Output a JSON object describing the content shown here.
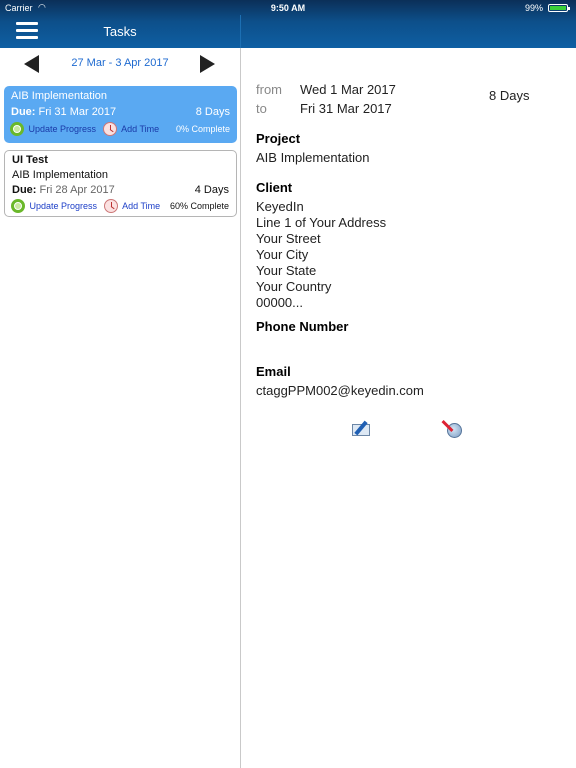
{
  "status_bar": {
    "carrier": "Carrier",
    "time": "9:50 AM",
    "battery": "99%"
  },
  "header": {
    "title": "Tasks"
  },
  "week_nav": {
    "label": "27 Mar - 3 Apr 2017"
  },
  "tasks": [
    {
      "title": "AIB Implementation",
      "due_label": "Due:",
      "due_date": "Fri 31 Mar 2017",
      "days": "8 Days",
      "update_progress": "Update Progress",
      "add_time": "Add Time",
      "percent": "0% Complete"
    },
    {
      "title": "UI Test",
      "project": "AIB Implementation",
      "due_label": "Due:",
      "due_date": "Fri 28 Apr 2017",
      "days": "4 Days",
      "update_progress": "Update Progress",
      "add_time": "Add Time",
      "percent": "60% Complete"
    }
  ],
  "detail": {
    "from_label": "from",
    "from_date": "Wed 1 Mar 2017",
    "to_label": "to",
    "to_date": "Fri 31 Mar 2017",
    "days": "8 Days",
    "project_heading": "Project",
    "project": "AIB Implementation",
    "client_heading": "Client",
    "client_lines": [
      "KeyedIn",
      "Line 1 of Your Address",
      "Your Street",
      "Your City",
      "Your State",
      "Your Country",
      "00000..."
    ],
    "phone_heading": "Phone Number",
    "email_heading": "Email",
    "email": "ctaggPPM002@keyedin.com"
  },
  "icons": {
    "menu": "hamburger-menu-icon",
    "prev": "arrow-left-icon",
    "next": "arrow-right-icon",
    "progress": "progress-ring-icon",
    "time": "clock-icon",
    "mail": "compose-email-icon",
    "web": "globe-compass-icon",
    "wifi": "wifi-icon"
  },
  "colors": {
    "header_top": "#0b2f58",
    "header_bottom": "#0e5fa3",
    "selected_card": "#5aa9f2",
    "link_blue": "#1e6ad0"
  }
}
